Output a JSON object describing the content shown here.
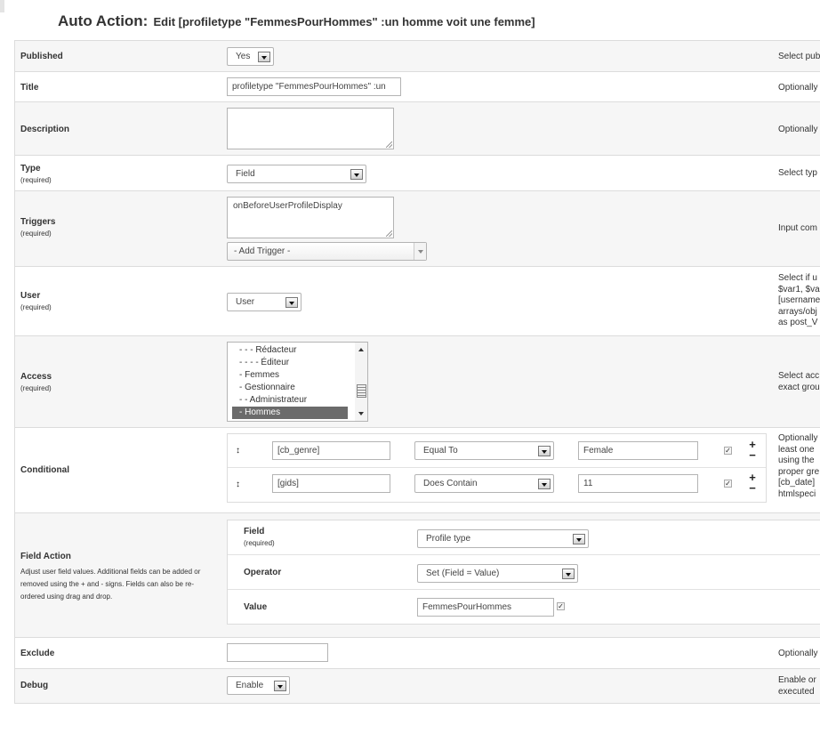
{
  "header": {
    "title_main": "Auto Action:",
    "title_sub": "Edit [profiletype \"FemmesPourHommes\" :un homme voit une femme]"
  },
  "required_label": "(required)",
  "published": {
    "label": "Published",
    "value": "Yes",
    "help": "Select pub"
  },
  "title": {
    "label": "Title",
    "value": "profiletype \"FemmesPourHommes\" :un",
    "help": "Optionally"
  },
  "description": {
    "label": "Description",
    "value": "",
    "help": "Optionally"
  },
  "type": {
    "label": "Type",
    "value": "Field",
    "help": "Select typ"
  },
  "triggers": {
    "label": "Triggers",
    "value": "onBeforeUserProfileDisplay",
    "add_trigger": "- Add Trigger -",
    "help": "Input com"
  },
  "user": {
    "label": "User",
    "value": "User",
    "help_lines": [
      "Select if u",
      "$var1, $va",
      "[username",
      "arrays/obj",
      "as post_V"
    ]
  },
  "access": {
    "label": "Access",
    "options": [
      "- - - Rédacteur",
      "- - - - Éditeur",
      "- Femmes",
      "- Gestionnaire",
      "- - Administrateur",
      "- Hommes"
    ],
    "selected_index": 5,
    "help_lines": [
      "Select acc",
      "exact grou"
    ]
  },
  "conditional": {
    "label": "Conditional",
    "rows": [
      {
        "field": "[cb_genre]",
        "operator": "Equal To",
        "value": "Female",
        "checked": true
      },
      {
        "field": "[gids]",
        "operator": "Does Contain",
        "value": "11",
        "checked": true
      }
    ],
    "help_lines": [
      "Optionally",
      "least one",
      "using the",
      "proper gre",
      "[cb_date]",
      "htmlspeci"
    ]
  },
  "field_action": {
    "label": "Field Action",
    "description": "Adjust user field values. Additional fields can be added or removed using the + and - signs. Fields can also be re-ordered using drag and drop.",
    "field_label": "Field",
    "field_value": "Profile type",
    "operator_label": "Operator",
    "operator_value": "Set (Field = Value)",
    "value_label": "Value",
    "value_value": "FemmesPourHommes",
    "value_checked": true
  },
  "exclude": {
    "label": "Exclude",
    "value": "",
    "help": "Optionally"
  },
  "debug": {
    "label": "Debug",
    "value": "Enable",
    "help_lines": [
      "Enable or",
      "executed"
    ]
  },
  "glyphs": {
    "drag": "↕",
    "plus": "+",
    "minus": "−",
    "check": "✓"
  }
}
